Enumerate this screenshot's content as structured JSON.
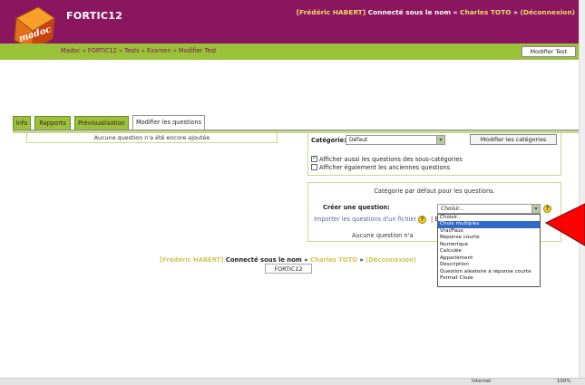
{
  "header": {
    "site_title": "FORTIC12",
    "logo_text": "madoc",
    "login": {
      "user": "[Frédéric HABERT]",
      "connected_as": "Connecté sous le nom «",
      "alias": "Charles TOTO",
      "close": "»",
      "logout": "(Déconnexion)"
    }
  },
  "navbar": {
    "breadcrumb": [
      "Madoc",
      "FORTIC12",
      "Tests",
      "Examen",
      "Modifier Test"
    ],
    "separator": "»",
    "modify_button": "Modifier Test"
  },
  "tabs": [
    {
      "label": "Info"
    },
    {
      "label": "Rapports"
    },
    {
      "label": "Prévisualisation"
    },
    {
      "label": "Modifier les questions"
    }
  ],
  "left_panel": {
    "no_questions": "Aucune question n'a été encore ajoutée"
  },
  "category_panel": {
    "label": "Catégorie:",
    "selected": "Défaut",
    "edit_button": "Modifier les catégories",
    "checkbox_subcats": "Afficher aussi les questions des sous-catégories",
    "checkbox_old": "Afficher également les anciennes questions"
  },
  "create_panel": {
    "default_category_text": "Catégorie par défaut pour les questions.",
    "create_label": "Créer une question:",
    "choose_value": "Choisir...",
    "import_link": "Importer les questions d'un fichier",
    "import_tail": "| E",
    "no_questions_partial": "Aucune question n'a"
  },
  "dropdown_options": [
    "Choisir...",
    "Choix multiples",
    "Vrai/Faux",
    "Réponse courte",
    "Numérique",
    "Calculée",
    "Appariement",
    "Description",
    "Question aléatoire à réponse courte",
    "Format Cloze"
  ],
  "dropdown_highlighted": "Choix multiples",
  "footer": {
    "user": "[Frédéric HABERT]",
    "connected_as": "Connecté sous le nom «",
    "alias": "Charles TOTO",
    "close": "»",
    "logout": "(Déconnexion)",
    "course_button": "FORTIC12"
  },
  "statusbar": {
    "zone": "Internet",
    "zoom": "100%"
  },
  "colors": {
    "header": "#8a1660",
    "navbar": "#9ac13a",
    "login_text": "#f3d96a",
    "arrow": "#ff0000",
    "dropdown_highlight": "#3369c6"
  }
}
